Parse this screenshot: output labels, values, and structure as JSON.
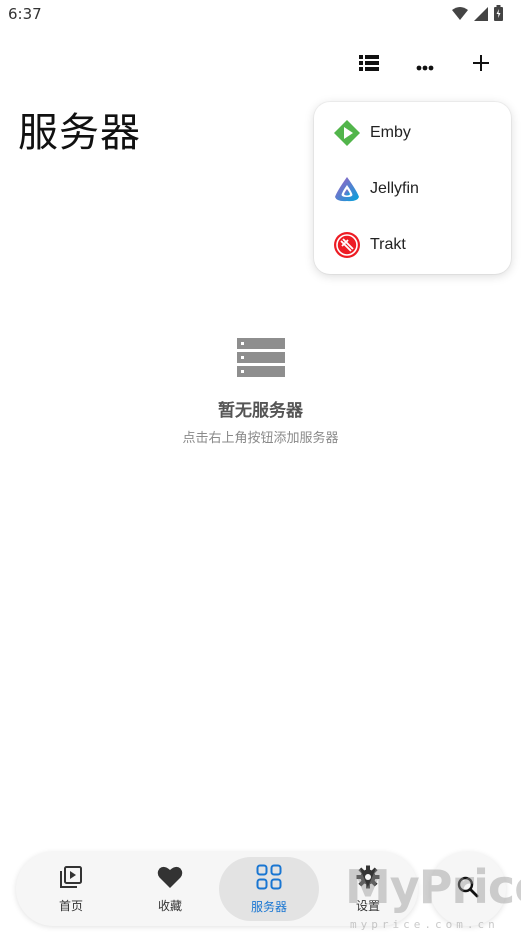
{
  "status_bar": {
    "time": "6:37"
  },
  "toolbar": {
    "icons": [
      "list-view-icon",
      "more-icon",
      "add-icon"
    ]
  },
  "page": {
    "title": "服务器"
  },
  "dropdown": {
    "items": [
      {
        "label": "Emby",
        "icon": "emby-logo",
        "color": "#52b54b"
      },
      {
        "label": "Jellyfin",
        "icon": "jellyfin-logo",
        "color": "#aa5cc3"
      },
      {
        "label": "Trakt",
        "icon": "trakt-logo",
        "color": "#ed1c24"
      }
    ]
  },
  "empty_state": {
    "icon": "server-icon",
    "title": "暂无服务器",
    "subtitle": "点击右上角按钮添加服务器"
  },
  "bottom_nav": {
    "items": [
      {
        "label": "首页",
        "icon": "video-library-icon",
        "active": false
      },
      {
        "label": "收藏",
        "icon": "heart-icon",
        "active": false
      },
      {
        "label": "服务器",
        "icon": "grid-icon",
        "active": true
      },
      {
        "label": "设置",
        "icon": "gear-icon",
        "active": false
      }
    ],
    "accent": "#1976d2"
  },
  "search": {
    "icon": "search-icon"
  },
  "watermark": {
    "main": "MyPrice",
    "sub": "myprice.com.cn"
  }
}
